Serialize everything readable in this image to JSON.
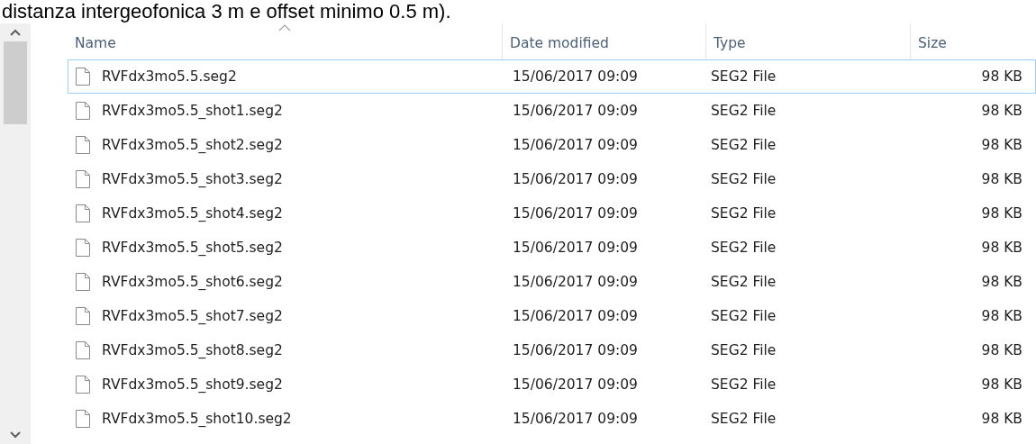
{
  "caption": "distanza intergeofonica 3 m e offset minimo 0.5 m).",
  "columns": [
    {
      "label": "Name",
      "sorted": true
    },
    {
      "label": "Date modified",
      "sorted": false
    },
    {
      "label": "Type",
      "sorted": false
    },
    {
      "label": "Size",
      "sorted": false
    }
  ],
  "rows": [
    {
      "name": "RVFdx3mo5.5.seg2",
      "date": "15/06/2017 09:09",
      "type": "SEG2 File",
      "size": "98 KB",
      "selected": true
    },
    {
      "name": "RVFdx3mo5.5_shot1.seg2",
      "date": "15/06/2017 09:09",
      "type": "SEG2 File",
      "size": "98 KB",
      "selected": false
    },
    {
      "name": "RVFdx3mo5.5_shot2.seg2",
      "date": "15/06/2017 09:09",
      "type": "SEG2 File",
      "size": "98 KB",
      "selected": false
    },
    {
      "name": "RVFdx3mo5.5_shot3.seg2",
      "date": "15/06/2017 09:09",
      "type": "SEG2 File",
      "size": "98 KB",
      "selected": false
    },
    {
      "name": "RVFdx3mo5.5_shot4.seg2",
      "date": "15/06/2017 09:09",
      "type": "SEG2 File",
      "size": "98 KB",
      "selected": false
    },
    {
      "name": "RVFdx3mo5.5_shot5.seg2",
      "date": "15/06/2017 09:09",
      "type": "SEG2 File",
      "size": "98 KB",
      "selected": false
    },
    {
      "name": "RVFdx3mo5.5_shot6.seg2",
      "date": "15/06/2017 09:09",
      "type": "SEG2 File",
      "size": "98 KB",
      "selected": false
    },
    {
      "name": "RVFdx3mo5.5_shot7.seg2",
      "date": "15/06/2017 09:09",
      "type": "SEG2 File",
      "size": "98 KB",
      "selected": false
    },
    {
      "name": "RVFdx3mo5.5_shot8.seg2",
      "date": "15/06/2017 09:09",
      "type": "SEG2 File",
      "size": "98 KB",
      "selected": false
    },
    {
      "name": "RVFdx3mo5.5_shot9.seg2",
      "date": "15/06/2017 09:09",
      "type": "SEG2 File",
      "size": "98 KB",
      "selected": false
    },
    {
      "name": "RVFdx3mo5.5_shot10.seg2",
      "date": "15/06/2017 09:09",
      "type": "SEG2 File",
      "size": "98 KB",
      "selected": false
    }
  ]
}
